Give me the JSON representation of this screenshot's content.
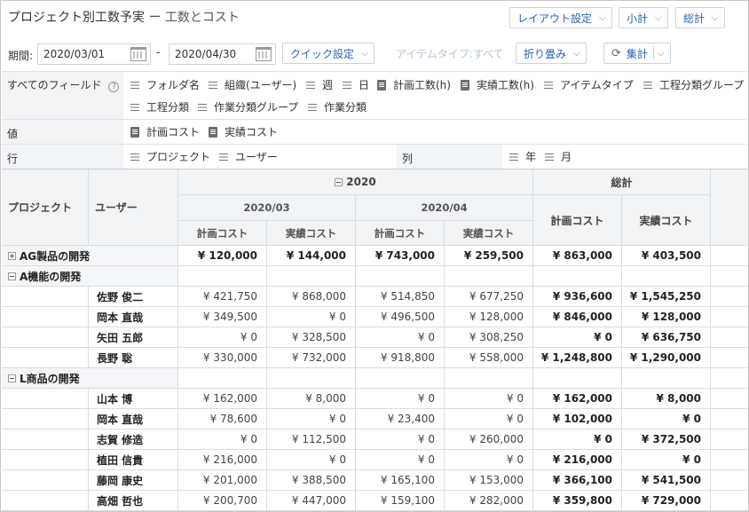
{
  "header": {
    "title": "プロジェクト別工数予実",
    "subtitle": "ー 工数とコスト",
    "layout_button": "レイアウト設定",
    "subtotal_button": "小計",
    "grandtotal_button": "総計"
  },
  "toolbar": {
    "period_label": "期間:",
    "date_from": "2020/03/01",
    "date_to": "2020/04/30",
    "range_sep": "-",
    "quick_button": "クイック設定",
    "item_type_filter": "アイテムタイプ:すべて",
    "collapse_button": "折り畳み",
    "aggregate_button": "集計"
  },
  "fields": {
    "all_label": "すべてのフィールド",
    "all_items": [
      {
        "label": "フォルダ名",
        "kind": "dimension"
      },
      {
        "label": "組織(ユーザー)",
        "kind": "dimension"
      },
      {
        "label": "週",
        "kind": "dimension"
      },
      {
        "label": "日",
        "kind": "dimension"
      },
      {
        "label": "計画工数(h)",
        "kind": "measure"
      },
      {
        "label": "実績工数(h)",
        "kind": "measure"
      },
      {
        "label": "アイテムタイプ",
        "kind": "dimension"
      },
      {
        "label": "工程分類グループ",
        "kind": "dimension"
      },
      {
        "label": "工程分類",
        "kind": "dimension"
      },
      {
        "label": "作業分類グループ",
        "kind": "dimension"
      },
      {
        "label": "作業分類",
        "kind": "dimension"
      }
    ],
    "values_label": "値",
    "values_items": [
      "計画コスト",
      "実績コスト"
    ],
    "rows_label": "行",
    "rows_items": [
      "プロジェクト",
      "ユーザー"
    ],
    "cols_label": "列",
    "cols_items": [
      "年",
      "月"
    ]
  },
  "pivot": {
    "col_project": "プロジェクト",
    "col_user": "ユーザー",
    "year": "2020",
    "months": [
      "2020/03",
      "2020/04"
    ],
    "total_label": "総計",
    "plan_cost": "計画コスト",
    "actual_cost": "実績コスト",
    "rows": [
      {
        "type": "group-collapsed",
        "project": "AG製品の開発",
        "values": [
          "¥ 120,000",
          "¥ 144,000",
          "¥ 743,000",
          "¥ 259,500",
          "¥ 863,000",
          "¥ 403,500"
        ]
      },
      {
        "type": "group-expanded",
        "project": "A機能の開発"
      },
      {
        "type": "user",
        "user": "佐野 俊二",
        "values": [
          "¥ 421,750",
          "¥ 868,000",
          "¥ 514,850",
          "¥ 677,250",
          "¥ 936,600",
          "¥ 1,545,250"
        ]
      },
      {
        "type": "user",
        "user": "岡本 直哉",
        "values": [
          "¥ 349,500",
          "¥ 0",
          "¥ 496,500",
          "¥ 128,000",
          "¥ 846,000",
          "¥ 128,000"
        ]
      },
      {
        "type": "user",
        "user": "矢田 五郎",
        "values": [
          "¥ 0",
          "¥ 328,500",
          "¥ 0",
          "¥ 308,250",
          "¥ 0",
          "¥ 636,750"
        ]
      },
      {
        "type": "user",
        "user": "長野 聡",
        "values": [
          "¥ 330,000",
          "¥ 732,000",
          "¥ 918,800",
          "¥ 558,000",
          "¥ 1,248,800",
          "¥ 1,290,000"
        ]
      },
      {
        "type": "group-expanded",
        "project": "L商品の開発"
      },
      {
        "type": "user",
        "user": "山本 博",
        "values": [
          "¥ 162,000",
          "¥ 8,000",
          "¥ 0",
          "¥ 0",
          "¥ 162,000",
          "¥ 8,000"
        ]
      },
      {
        "type": "user",
        "user": "岡本 直哉",
        "values": [
          "¥ 78,600",
          "¥ 0",
          "¥ 23,400",
          "¥ 0",
          "¥ 102,000",
          "¥ 0"
        ]
      },
      {
        "type": "user",
        "user": "志賀 修造",
        "values": [
          "¥ 0",
          "¥ 112,500",
          "¥ 0",
          "¥ 260,000",
          "¥ 0",
          "¥ 372,500"
        ]
      },
      {
        "type": "user",
        "user": "植田 信貴",
        "values": [
          "¥ 216,000",
          "¥ 0",
          "¥ 0",
          "¥ 0",
          "¥ 216,000",
          "¥ 0"
        ]
      },
      {
        "type": "user",
        "user": "藤岡 康史",
        "values": [
          "¥ 201,000",
          "¥ 388,500",
          "¥ 165,100",
          "¥ 153,000",
          "¥ 366,100",
          "¥ 541,500"
        ]
      },
      {
        "type": "user",
        "user": "高畑 哲也",
        "values": [
          "¥ 200,700",
          "¥ 447,000",
          "¥ 159,100",
          "¥ 282,000",
          "¥ 359,800",
          "¥ 729,000"
        ]
      }
    ]
  }
}
